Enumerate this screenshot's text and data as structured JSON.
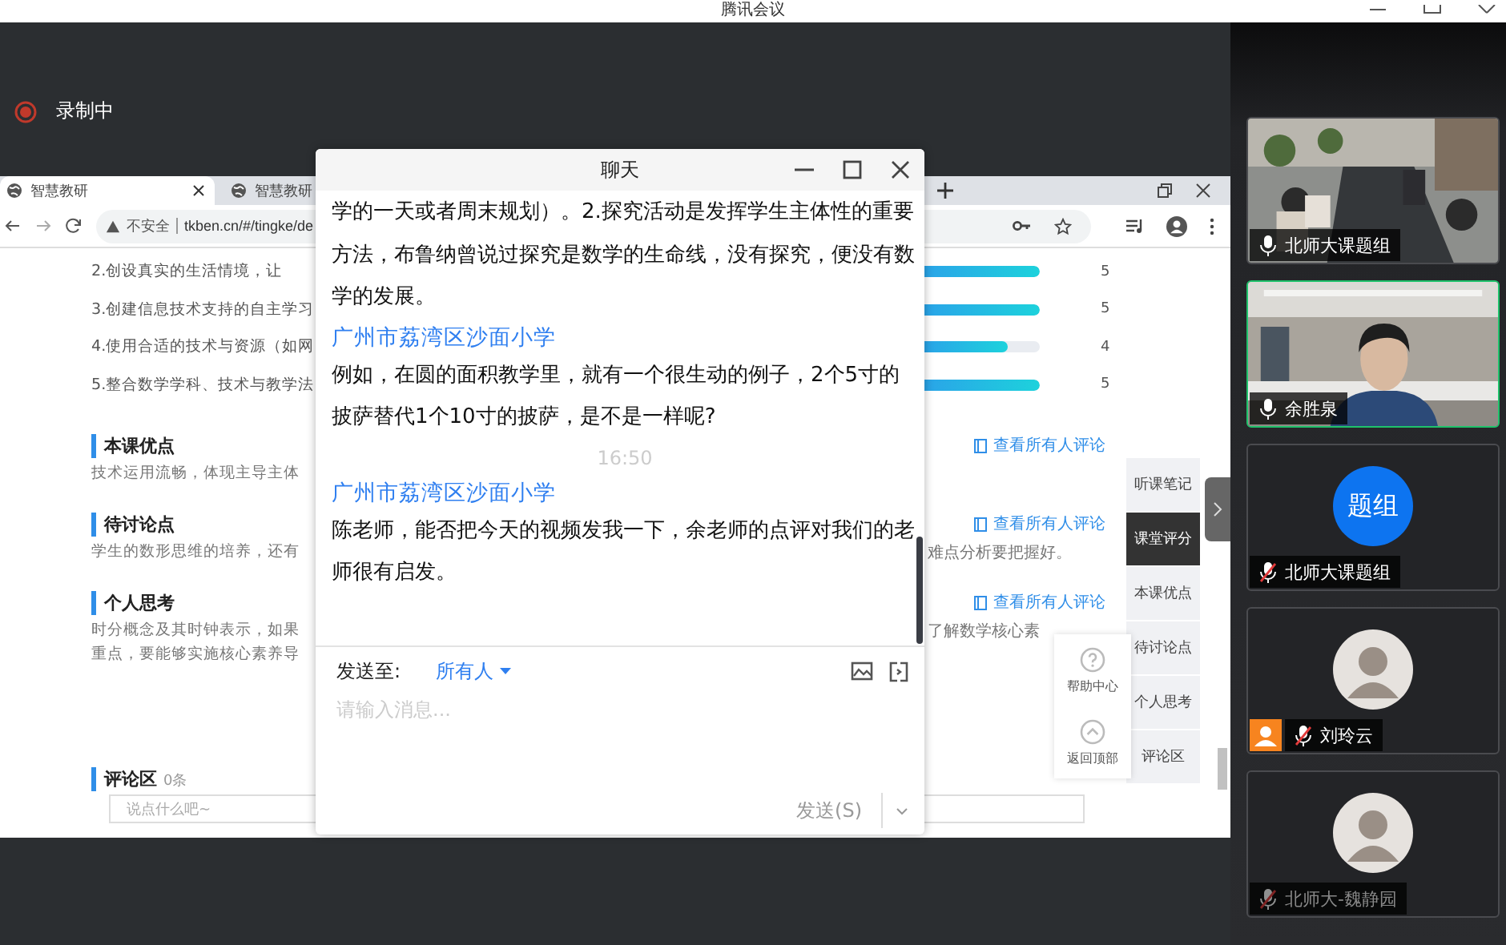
{
  "app_title": "腾讯会议",
  "recording": {
    "label": "录制中"
  },
  "browser": {
    "tabs": [
      {
        "label": "智慧教研",
        "selected": true
      },
      {
        "label": "智慧教研",
        "selected": false
      }
    ],
    "address": {
      "security": "不安全",
      "url": "tkben.cn/#/tingke/de"
    },
    "rating_items": [
      {
        "text": "2.创设真实的生活情境，让",
        "level": 1,
        "score": "5"
      },
      {
        "text": "3.创建信息技术支持的自主学习",
        "level": 1,
        "score": "5"
      },
      {
        "text": "4.使用合适的技术与资源（如网",
        "level": 0.72,
        "score": "4"
      },
      {
        "text": "5.整合数学学科、技术与教学法",
        "level": 1,
        "score": "5"
      }
    ],
    "sections": [
      {
        "heading": "本课优点",
        "link": "查看所有人评论",
        "lines": [
          {
            "left": "技术运用流畅，体现主导主体"
          }
        ]
      },
      {
        "heading": "待讨论点",
        "link": "查看所有人评论",
        "lines": [
          {
            "left": "学生的数形思维的培养，还有",
            "right": "难点分析要把握好。"
          }
        ]
      },
      {
        "heading": "个人思考",
        "link": "查看所有人评论",
        "lines": [
          {
            "left": "时分概念及其时钟表示，如果",
            "right": "了解数学核心素"
          },
          {
            "left": "重点，要能够实施核心素养导"
          }
        ]
      }
    ],
    "comments": {
      "heading": "评论区",
      "count": "0条",
      "placeholder": "说点什么吧~"
    },
    "side_nav": [
      {
        "label": "听课笔记",
        "selected": false
      },
      {
        "label": "课堂评分",
        "selected": true
      },
      {
        "label": "本课优点",
        "selected": false
      },
      {
        "label": "待讨论点",
        "selected": false
      },
      {
        "label": "个人思考",
        "selected": false
      },
      {
        "label": "评论区",
        "selected": false
      }
    ],
    "float_buttons": [
      {
        "kind": "help",
        "label": "帮助中心"
      },
      {
        "kind": "top",
        "label": "返回顶部"
      }
    ]
  },
  "chat": {
    "title": "聊天",
    "messages": [
      {
        "kind": "text",
        "text": "学的一天或者周末规划）。2.探究活动是发挥学生主体性的重要方法，布鲁纳曾说过探究是数学的生命线，没有探究，便没有数学的发展。"
      },
      {
        "kind": "sender",
        "text": "广州市荔湾区沙面小学"
      },
      {
        "kind": "text",
        "text": "例如，在圆的面积教学里，就有一个很生动的例子，2个5寸的披萨替代1个10寸的披萨，是不是一样呢?"
      },
      {
        "kind": "time",
        "text": "16:50"
      },
      {
        "kind": "sender",
        "text": "广州市荔湾区沙面小学"
      },
      {
        "kind": "text",
        "text": "陈老师，能否把今天的视频发我一下，余老师的点评对我们的老师很有启发。"
      }
    ],
    "send_to_label": "发送至:",
    "recipient": "所有人",
    "placeholder": "请输入消息...",
    "send_button": {
      "label": "发送(S)",
      "disabled": true
    }
  },
  "participants": [
    {
      "kind": "video",
      "name": "北师大课题组",
      "muted": false,
      "active": false,
      "host": false,
      "dimmed": false
    },
    {
      "kind": "video_person",
      "name": "余胜泉",
      "muted": false,
      "active": true,
      "host": false,
      "dimmed": false
    },
    {
      "kind": "avatar_text",
      "avatar_text": "题组",
      "name": "北师大课题组",
      "muted": true,
      "active": false,
      "host": false,
      "dimmed": false
    },
    {
      "kind": "avatar_image",
      "name": "刘玲云",
      "muted": true,
      "active": false,
      "host": true,
      "dimmed": false
    },
    {
      "kind": "avatar_image",
      "name": "北师大-魏静园",
      "muted": true,
      "active": false,
      "host": false,
      "dimmed": true
    }
  ]
}
